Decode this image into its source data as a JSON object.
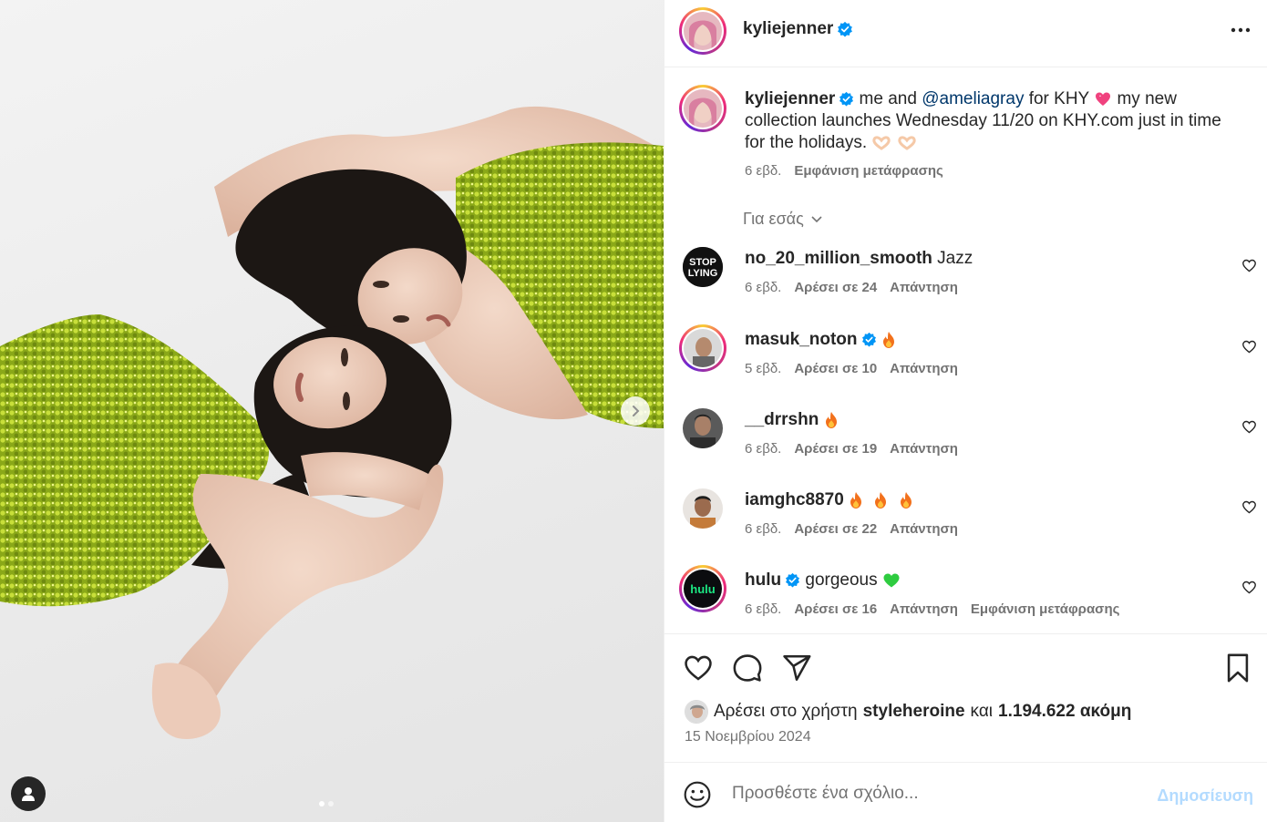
{
  "header": {
    "username": "kyliejenner"
  },
  "caption": {
    "username": "kyliejenner",
    "text_before_mention": " me and ",
    "mention": "@ameliagray",
    "text_after_mention": " for KHY",
    "text_rest": " my new collection launches Wednesday 11/20 on KHY.com just in time for the holidays.",
    "time": "6 εβδ.",
    "translate_label": "Εμφάνιση μετάφρασης"
  },
  "for_you_label": "Για εσάς",
  "comments": [
    {
      "username": "no_20_million_smooth",
      "text": "Jazz",
      "time": "6 εβδ.",
      "likes": "Αρέσει σε 24",
      "reply": "Απάντηση"
    },
    {
      "username": "masuk_noton",
      "text": "",
      "time": "5 εβδ.",
      "likes": "Αρέσει σε 10",
      "reply": "Απάντηση"
    },
    {
      "username": "__drrshn",
      "text": "",
      "time": "6 εβδ.",
      "likes": "Αρέσει σε 19",
      "reply": "Απάντηση"
    },
    {
      "username": "iamghc8870",
      "text": "",
      "time": "6 εβδ.",
      "likes": "Αρέσει σε 22",
      "reply": "Απάντηση"
    },
    {
      "username": "hulu",
      "text": "gorgeous",
      "time": "6 εβδ.",
      "likes": "Αρέσει σε 16",
      "reply": "Απάντηση",
      "translate": "Εμφάνιση μετάφρασης"
    }
  ],
  "avatar_labels": {
    "stop_lying_line1": "STOP",
    "stop_lying_line2": "LYING",
    "hulu": "hulu"
  },
  "likes": {
    "prefix": "Αρέσει στο χρήστη",
    "user": "styleheroine",
    "conjunction": "και",
    "count": "1.194.622 ακόμη"
  },
  "date": "15 Νοεμβρίου 2024",
  "add_comment": {
    "placeholder": "Προσθέστε ένα σχόλιο...",
    "post_label": "Δημοσίευση"
  },
  "carousel": {
    "slide_count": 2,
    "active_slide": 1
  },
  "colors": {
    "verified": "#0095f6",
    "link": "#00376b",
    "muted": "#737373",
    "post_disabled": "#b3dbff",
    "sequin_green": "#9fbf1f"
  }
}
